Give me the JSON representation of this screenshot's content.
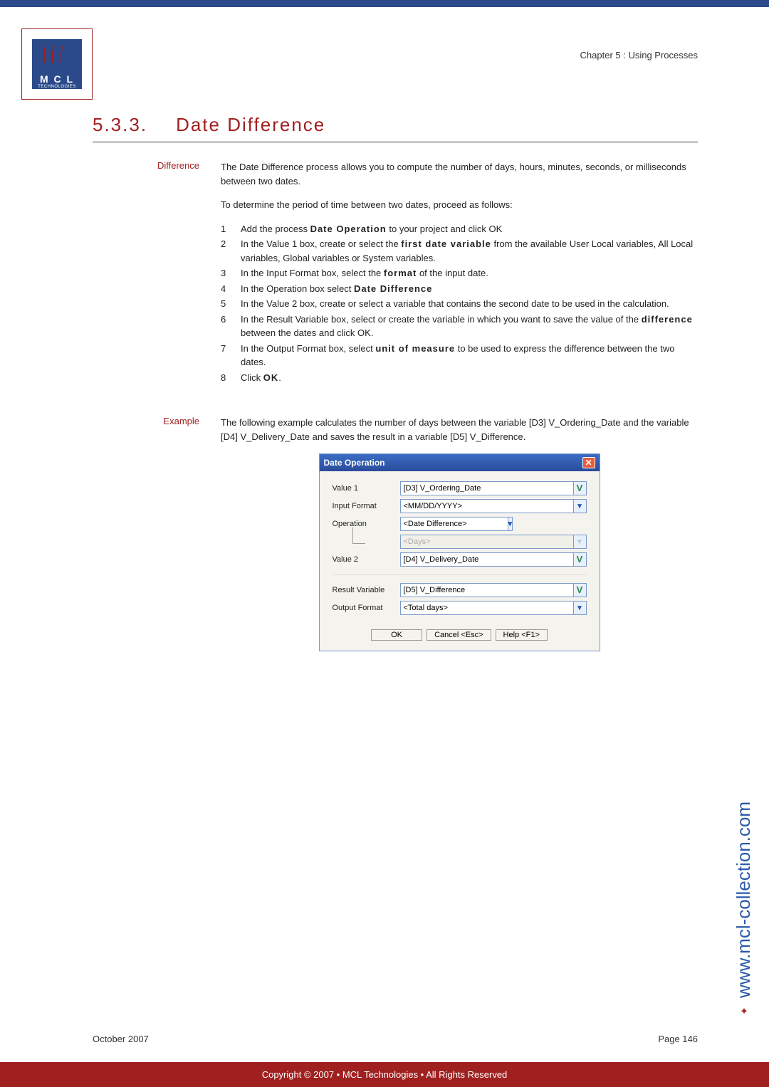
{
  "chapter": "Chapter 5 : Using Processes",
  "logo": {
    "letters": "M C L",
    "sub": "TECHNOLOGIES"
  },
  "heading": {
    "number": "5.3.3.",
    "title": "Date Difference"
  },
  "sections": {
    "difference": {
      "label": "Difference",
      "intro": "The Date Difference process allows you to compute the number of days, hours, minutes, seconds, or milliseconds between two dates.",
      "lead": "To determine the period of time between two dates, proceed as follows:",
      "steps": [
        {
          "n": "1",
          "pre": "Add the process ",
          "bold": "Date Operation",
          "post": " to your project and click OK"
        },
        {
          "n": "2",
          "pre": "In the Value 1 box, create or select the ",
          "bold": "first date variable",
          "post": " from the available User Local variables, All Local variables, Global variables or System variables."
        },
        {
          "n": "3",
          "pre": "In the Input Format box, select the ",
          "bold": "format",
          "post": " of the input date."
        },
        {
          "n": "4",
          "pre": "In the Operation box select ",
          "bold": "Date Difference",
          "post": ""
        },
        {
          "n": "5",
          "pre": "In the Value 2 box, create or select a variable that contains the second date to be used in the calculation.",
          "bold": "",
          "post": ""
        },
        {
          "n": "6",
          "pre": "In the Result Variable box, select or create the variable in which you want to save the value of the ",
          "bold": "difference",
          "post": " between the dates and click OK."
        },
        {
          "n": "7",
          "pre": "In the Output Format box, select ",
          "bold": "unit of measure",
          "post": " to be used to express the difference between the two dates."
        },
        {
          "n": "8",
          "pre": "Click ",
          "bold": "OK",
          "post": "."
        }
      ]
    },
    "example": {
      "label": "Example",
      "text": "The following example calculates the number of days between the variable [D3] V_Ordering_Date and the variable [D4] V_Delivery_Date and saves the result in a variable [D5] V_Difference."
    }
  },
  "dialog": {
    "title": "Date Operation",
    "labels": {
      "value1": "Value 1",
      "inputFormat": "Input Format",
      "operation": "Operation",
      "value2": "Value 2",
      "resultVariable": "Result Variable",
      "outputFormat": "Output Format"
    },
    "values": {
      "value1": "[D3] V_Ordering_Date",
      "inputFormat": "<MM/DD/YYYY>",
      "operation": "<Date Difference>",
      "opUnit": "<Days>",
      "value2": "[D4] V_Delivery_Date",
      "resultVariable": "[D5] V_Difference",
      "outputFormat": "<Total days>"
    },
    "buttons": {
      "ok": "OK",
      "cancel": "Cancel <Esc>",
      "help": "Help <F1>"
    }
  },
  "vertical_url": "www.mcl-collection.com",
  "vertical_dots": "✦",
  "footer": {
    "date": "October 2007",
    "page": "Page 146"
  },
  "copyright": "Copyright © 2007 • MCL Technologies • All Rights Reserved"
}
